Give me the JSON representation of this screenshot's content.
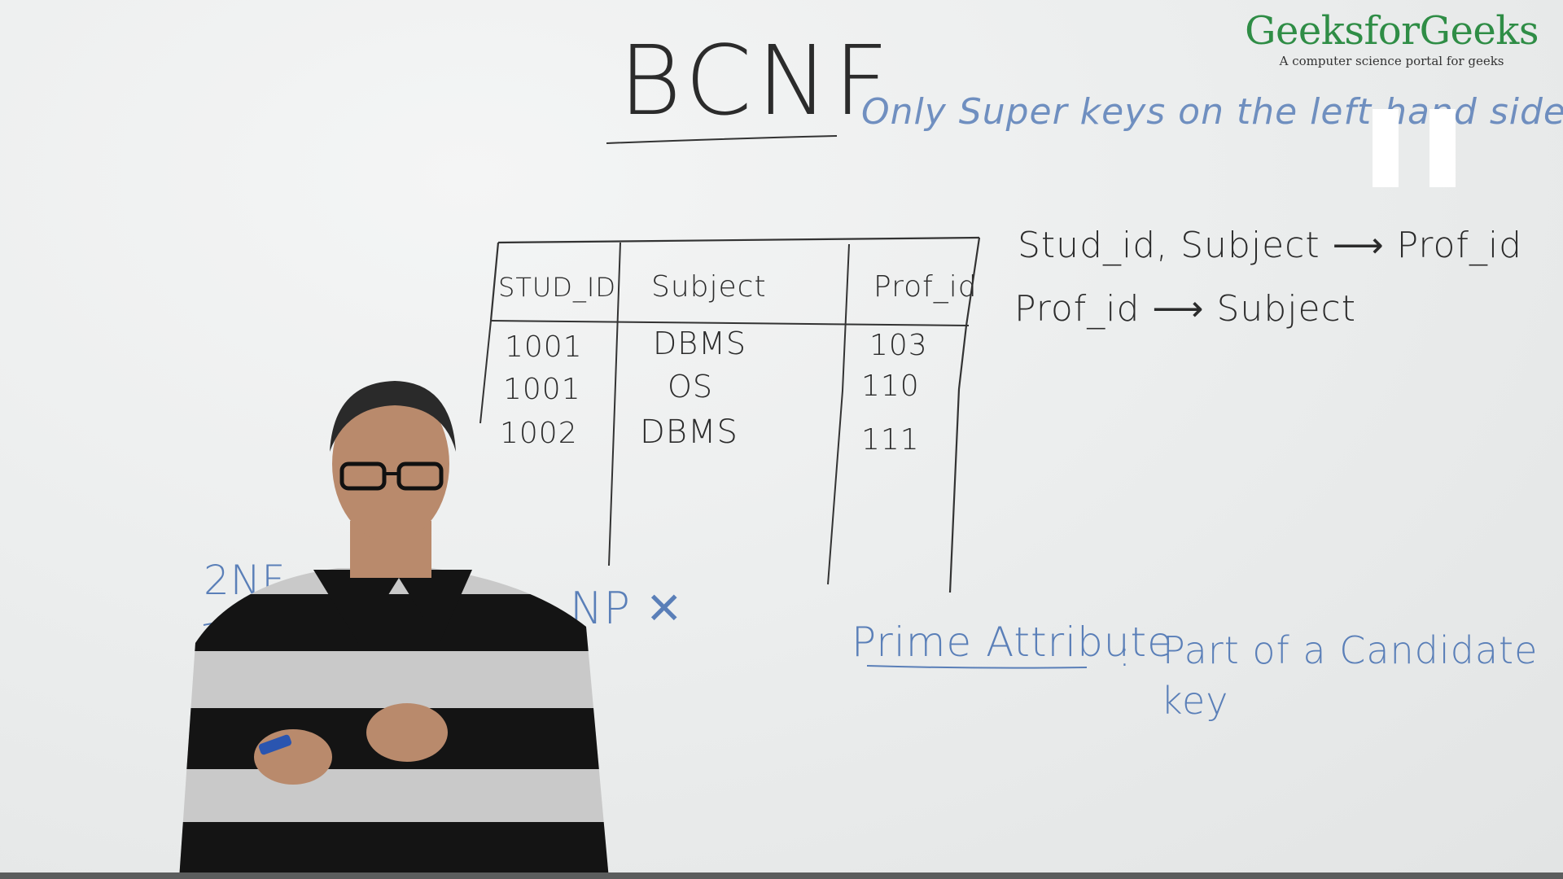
{
  "logo": {
    "title": "GeeksforGeeks",
    "tagline": "A computer science portal for geeks"
  },
  "board": {
    "heading": "BCNF",
    "bcnf_note": "Only Super keys on the left hand side",
    "table": {
      "columns": [
        "STUD_ID",
        "Subject",
        "Prof_id"
      ],
      "rows": [
        [
          "1001",
          "DBMS",
          "103"
        ],
        [
          "1001",
          "OS",
          "110"
        ],
        [
          "1002",
          "DBMS",
          "111"
        ]
      ]
    },
    "fds": [
      "Stud_id, Subject ⟶ Prof_id",
      "Prof_id ⟶ Subject"
    ],
    "left_note": "2NF",
    "mid_note": "NP ✕",
    "prime_attribute_term": "Prime Attribute",
    "prime_attribute_sep": ":",
    "prime_attribute_def_line1": "Part of a Candidate",
    "prime_attribute_def_line2": "key"
  },
  "player": {
    "control_icon": "pause-icon"
  },
  "colors": {
    "brand": "#2f8d46",
    "marker_black": "#2b2b2b",
    "marker_blue": "#5a7fb8",
    "board": "#eceeee"
  }
}
